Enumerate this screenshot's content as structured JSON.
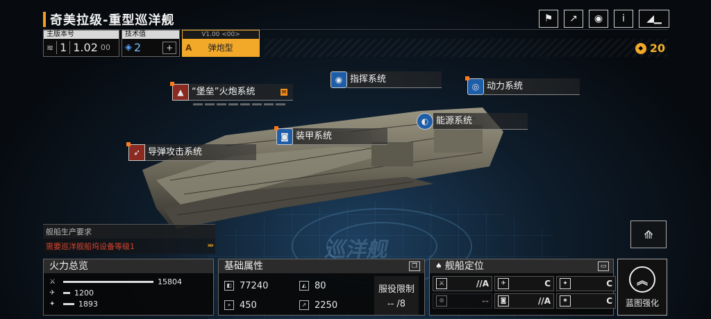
{
  "header": {
    "title": "奇美拉级-重型巡洋舰",
    "version_label": "主版本号",
    "version_tier": "1",
    "version_value": "1.02",
    "version_sub": "00",
    "tech_label": "技术值",
    "tech_value": "2",
    "variant_version": "V1.00 <00>",
    "variant_grade": "A",
    "variant_name": "弹炮型",
    "currency_value": "20"
  },
  "top_icons": [
    "share-icon",
    "external-link-icon",
    "view-icon",
    "info-icon",
    "back-icon"
  ],
  "systems": {
    "fortress": "“堡垒”火炮系统",
    "command": "指挥系统",
    "power": "动力系统",
    "energy": "能源系统",
    "armor": "装甲系统",
    "missile": "导弹攻击系统",
    "fortress_badge": "M"
  },
  "watermark": "巡洋舰",
  "production": {
    "header": "舰船生产要求",
    "requirement": "需要巡洋舰船坞设备等级1"
  },
  "firepower": {
    "title": "火力总览",
    "rows": [
      {
        "icon": "anti-ship-icon",
        "value": 15804
      },
      {
        "icon": "anti-aircraft-icon",
        "value": 1200
      },
      {
        "icon": "siege-icon",
        "value": 1893
      }
    ],
    "max": 15804
  },
  "attributes": {
    "title": "基础属性",
    "hp": "77240",
    "armor": "80",
    "speed": "450",
    "warp": "2250",
    "service_label": "服役限制",
    "service_value": "-- /8"
  },
  "positioning": {
    "title": "舰船定位",
    "roles": [
      {
        "grade": "//A",
        "dim": false
      },
      {
        "grade": "C",
        "dim": false
      },
      {
        "grade": "C",
        "dim": false
      },
      {
        "grade": "--",
        "dim": true
      },
      {
        "grade": "//A",
        "dim": false
      },
      {
        "grade": "C",
        "dim": false
      }
    ]
  },
  "blueprint": {
    "label": "蓝图强化"
  },
  "colors": {
    "accent": "#f2a92a",
    "warning": "#d8432c",
    "system_red": "#8a2a20",
    "system_blue": "#1e5da8"
  }
}
